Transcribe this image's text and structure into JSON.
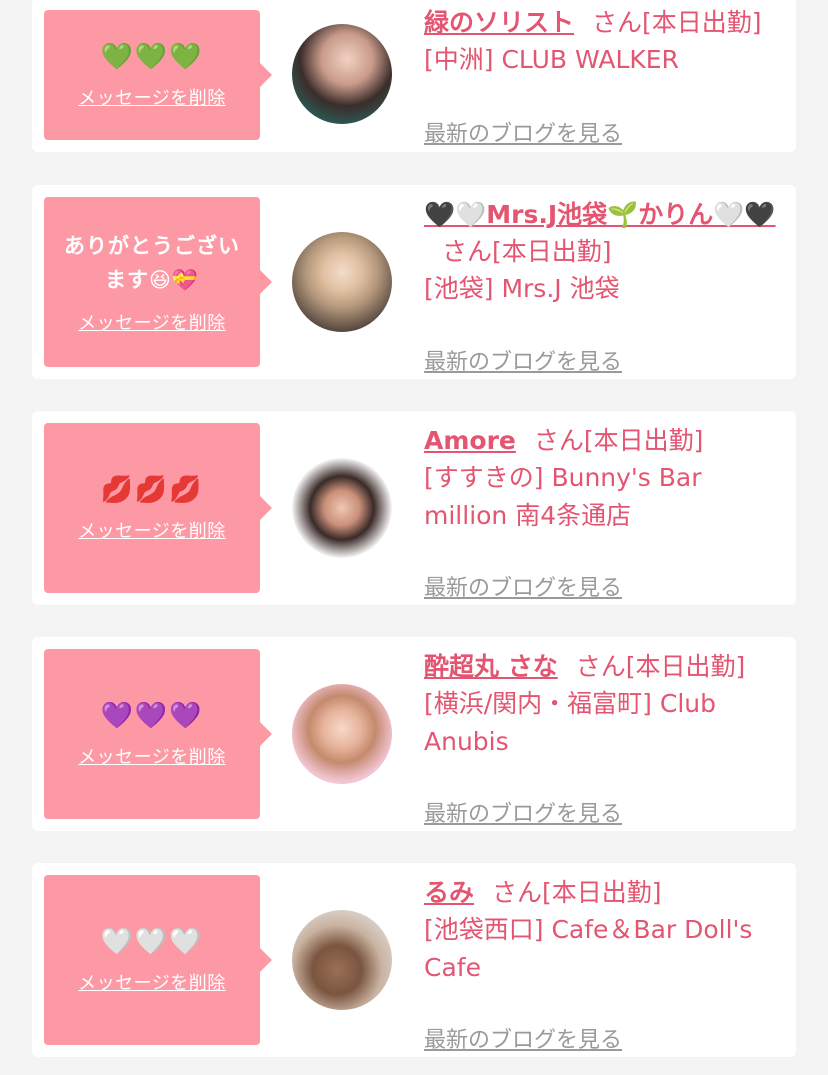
{
  "colors": {
    "accent": "#e35570",
    "bubble": "#fd99a5",
    "link_gray": "#9a9a9a"
  },
  "cards": [
    {
      "message": "💚💚💚",
      "delete_label": "メッセージを削除",
      "name": "緑のソリスト",
      "suffix": "さん[本日出勤]",
      "shop": "[中洲] CLUB WALKER",
      "blog_label": "最新のブログを見る"
    },
    {
      "message": "ありがとうございます😆💝",
      "delete_label": "メッセージを削除",
      "name": "🖤🤍Mrs.J池袋🌱かりん🤍🖤",
      "suffix": "さん[本日出勤]",
      "shop": "[池袋] Mrs.J 池袋",
      "blog_label": "最新のブログを見る"
    },
    {
      "message": "💋💋💋",
      "delete_label": "メッセージを削除",
      "name": "Amore",
      "suffix": "さん[本日出勤]",
      "shop": "[すすきの] Bunny's Bar million 南4条通店",
      "blog_label": "最新のブログを見る"
    },
    {
      "message": "💜💜💜",
      "delete_label": "メッセージを削除",
      "name": "酔超丸 さな",
      "suffix": "さん[本日出勤]",
      "shop": "[横浜/関内・福富町] Club Anubis",
      "blog_label": "最新のブログを見る"
    },
    {
      "message": "🤍🤍🤍",
      "delete_label": "メッセージを削除",
      "name": "るみ",
      "suffix": "さん[本日出勤]",
      "shop": "[池袋西口] Cafe＆Bar Doll's Cafe",
      "blog_label": "最新のブログを見る"
    }
  ]
}
